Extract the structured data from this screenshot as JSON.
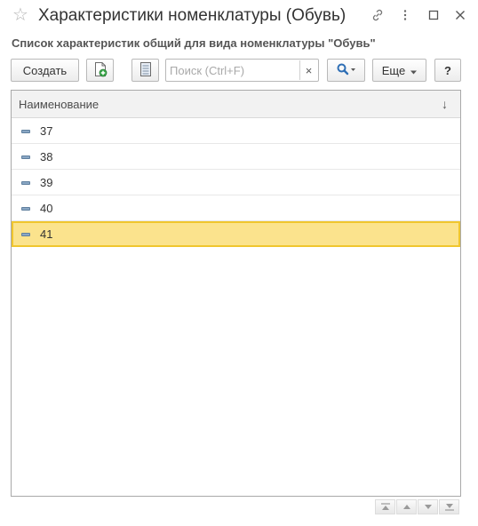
{
  "window": {
    "title": "Характеристики номенклатуры (Обувь)",
    "icons": [
      "star-icon",
      "link-icon",
      "more-vertical-icon",
      "maximize-icon",
      "close-icon"
    ]
  },
  "subtitle": "Список характеристик общий для вида номенклатуры \"Обувь\"",
  "toolbar": {
    "create_label": "Создать",
    "search_placeholder": "Поиск (Ctrl+F)",
    "search_value": "",
    "clear_label": "×",
    "more_label": "Еще",
    "help_label": "?"
  },
  "table": {
    "column_header": "Наименование",
    "sort_indicator": "↓",
    "rows": [
      "37",
      "38",
      "39",
      "40",
      "41"
    ],
    "selected_index": 4
  },
  "colors": {
    "selected_row": "#fbe38d",
    "selected_border": "#f0c62e",
    "header_bg": "#f2f2f2",
    "accent_green": "#3aa84a",
    "accent_blue": "#2f6fb5"
  }
}
